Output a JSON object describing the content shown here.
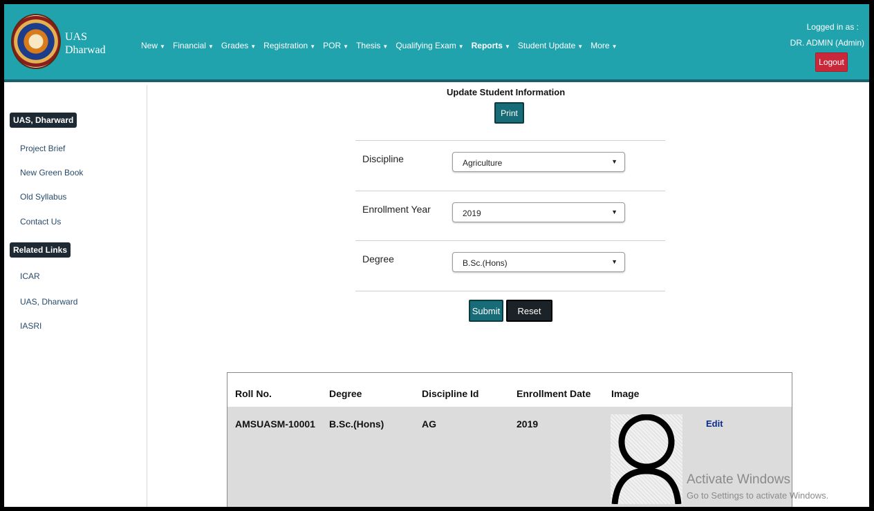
{
  "header": {
    "brand_line1": "UAS",
    "brand_line2": "Dharwad",
    "nav": [
      {
        "label": "New",
        "bold": false
      },
      {
        "label": "Financial",
        "bold": false
      },
      {
        "label": "Grades",
        "bold": false
      },
      {
        "label": "Registration",
        "bold": false
      },
      {
        "label": "POR",
        "bold": false
      },
      {
        "label": "Thesis",
        "bold": false
      },
      {
        "label": "Qualifying Exam",
        "bold": false
      },
      {
        "label": "Reports",
        "bold": true
      },
      {
        "label": "Student Update",
        "bold": false
      },
      {
        "label": "More",
        "bold": false
      }
    ],
    "logged_in_label": "Logged in as :",
    "user": "DR. ADMIN (Admin)",
    "logout_label": "Logout"
  },
  "sidebar": {
    "heading1": "UAS, Dharward",
    "links1": [
      "Project Brief",
      "New Green Book",
      "Old Syllabus",
      "Contact Us"
    ],
    "heading2": "Related Links",
    "links2": [
      "ICAR",
      "UAS, Dharward",
      "IASRI"
    ]
  },
  "form": {
    "title": "Update Student Information",
    "print_label": "Print",
    "discipline_label": "Discipline",
    "discipline_value": "Agriculture",
    "year_label": "Enrollment Year",
    "year_value": "2019",
    "degree_label": "Degree",
    "degree_value": "B.Sc.(Hons)",
    "submit_label": "Submit",
    "reset_label": "Reset"
  },
  "table": {
    "headers": [
      "Roll No.",
      "Degree",
      "Discipline Id",
      "Enrollment Date",
      "Image"
    ],
    "rows": [
      {
        "roll_no": "AMSUASM-10001",
        "degree": "B.Sc.(Hons)",
        "discipline_id": "AG",
        "enrollment_date": "2019",
        "edit_label": "Edit"
      }
    ]
  },
  "watermark": {
    "title": "Activate Windows",
    "subtitle": "Go to Settings to activate Windows."
  }
}
